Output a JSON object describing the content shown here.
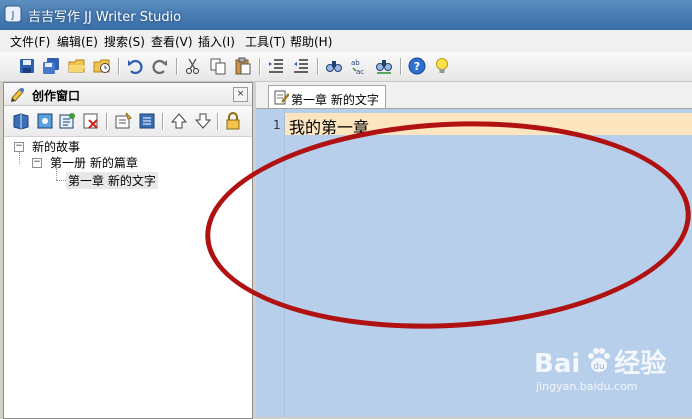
{
  "window": {
    "title": "吉吉写作 JJ Writer Studio",
    "app_icon": "jj-app-icon"
  },
  "menu": {
    "items": [
      {
        "label": "文件(F)"
      },
      {
        "label": "编辑(E)"
      },
      {
        "label": "搜索(S)"
      },
      {
        "label": "查看(V)"
      },
      {
        "label": "插入(I)"
      },
      {
        "label": "工具(T)"
      },
      {
        "label": "帮助(H)"
      }
    ]
  },
  "toolbar": {
    "icons": [
      "save-icon",
      "save-all-icon",
      "open-folder-icon",
      "open-recent-icon",
      "undo-icon",
      "redo-icon",
      "cut-icon",
      "copy-icon",
      "paste-icon",
      "indent-icon",
      "outdent-icon",
      "find-icon",
      "replace-icon",
      "find-next-icon",
      "help-icon",
      "tip-icon"
    ]
  },
  "left_panel": {
    "title": "创作窗口",
    "close_label": "×",
    "toolbar_icons": [
      "new-book-icon",
      "new-volume-icon",
      "new-chapter-icon",
      "delete-icon",
      "rename-icon",
      "properties-icon",
      "move-up-icon",
      "move-down-icon",
      "lock-icon"
    ],
    "tree": {
      "root": "新的故事",
      "volume": "第一册 新的篇章",
      "chapter": "第一章 新的文字"
    }
  },
  "editor": {
    "tab_label": "第一章 新的文字",
    "line_number": "1",
    "line_text": "我的第一章"
  },
  "watermark": {
    "logo_text": "Bai",
    "logo_suffix": "经验",
    "site": "jingyan.baidu.com"
  },
  "colors": {
    "editor_bg": "#b7cfea",
    "current_line": "#fde5c0",
    "annotation": "#b01212",
    "titlebar": "#4a7eb5"
  }
}
